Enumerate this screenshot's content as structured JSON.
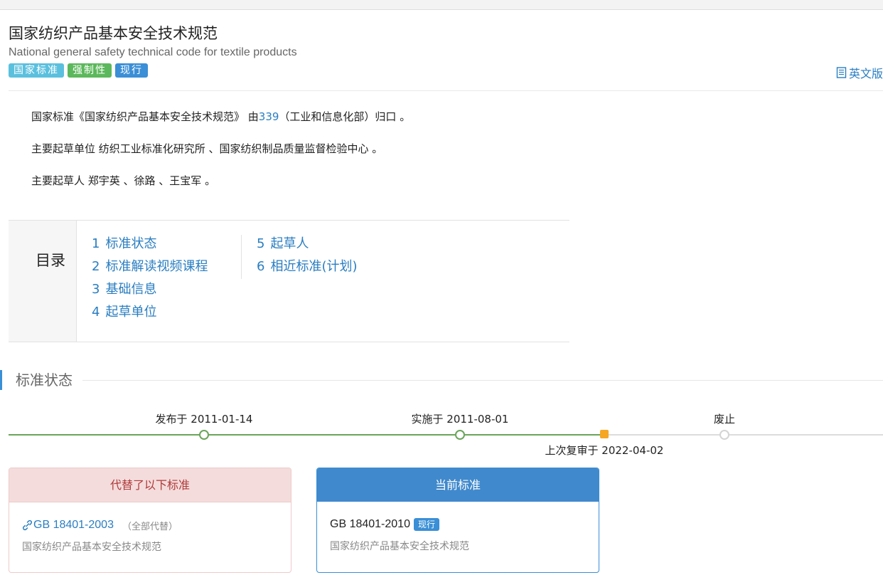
{
  "header": {
    "title": "国家纺织产品基本安全技术规范",
    "subtitle": "National general safety technical code for textile products",
    "tags": [
      "国家标准",
      "强制性",
      "现行"
    ],
    "english_link": "英文版"
  },
  "description": {
    "line1_prefix": "国家标准《国家纺织产品基本安全技术规范》 由",
    "line1_link": "339",
    "line1_suffix": "（工业和信息化部）归口 。",
    "line2": "主要起草单位 纺织工业标准化研究所 、国家纺织制品质量监督检验中心 。",
    "line3": "主要起草人 郑宇英 、徐路 、王宝军 。"
  },
  "toc": {
    "label": "目录",
    "items": [
      {
        "num": "1",
        "label": "标准状态"
      },
      {
        "num": "2",
        "label": "标准解读视频课程"
      },
      {
        "num": "3",
        "label": "基础信息"
      },
      {
        "num": "4",
        "label": "起草单位"
      },
      {
        "num": "5",
        "label": "起草人"
      },
      {
        "num": "6",
        "label": "相近标准(计划)"
      }
    ]
  },
  "status_section": {
    "title": "标准状态",
    "timeline": {
      "published": "发布于 2011-01-14",
      "implemented": "实施于 2011-08-01",
      "reviewed": "上次复审于 2022-04-02",
      "abolished": "废止"
    }
  },
  "replaced_card": {
    "header": "代替了以下标准",
    "code": "GB 18401-2003",
    "note": "（全部代替）",
    "name": "国家纺织产品基本安全技术规范"
  },
  "current_card": {
    "header": "当前标准",
    "code": "GB 18401-2010",
    "badge": "现行",
    "name": "国家纺织产品基本安全技术规范"
  },
  "colors": {
    "accent": "#3a8fd6",
    "link": "#2a7ec1",
    "timeline_done": "#6aa55a",
    "timeline_pending": "#d4d4d4",
    "review_marker": "#f5a623"
  }
}
